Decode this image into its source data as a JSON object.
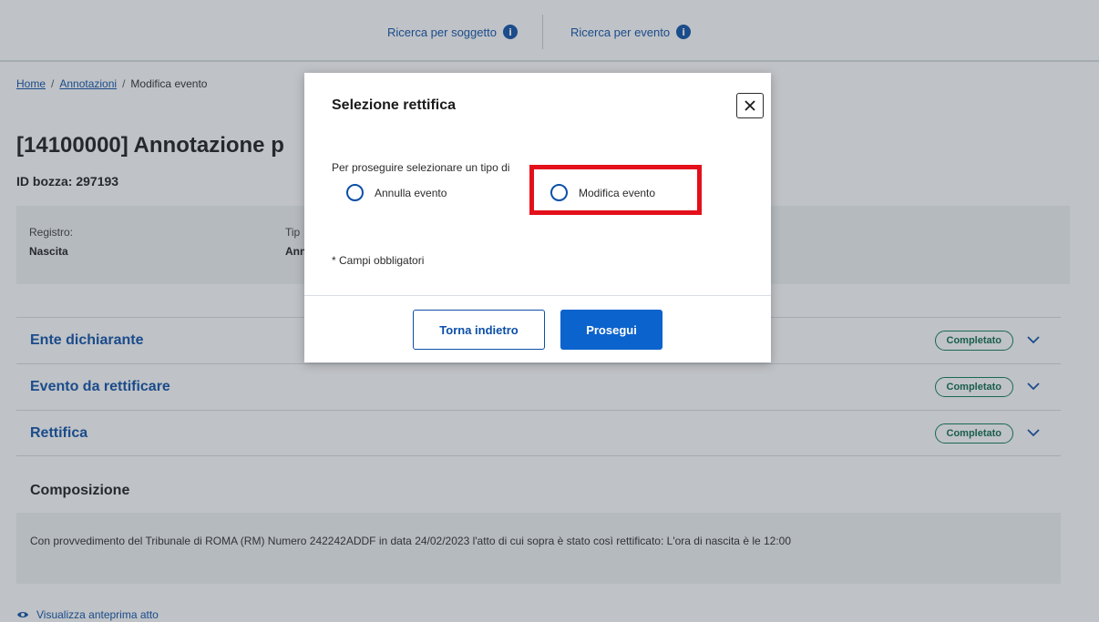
{
  "header": {
    "nav_subject": "Ricerca per soggetto",
    "nav_event": "Ricerca per evento",
    "info_glyph": "i"
  },
  "breadcrumb": {
    "home": "Home",
    "sep": "/",
    "annotations": "Annotazioni",
    "current": "Modifica evento"
  },
  "page": {
    "title": "[14100000] Annotazione p",
    "draft_id": "ID bozza: 297193"
  },
  "info_box": {
    "registry_label": "Registro:",
    "registry_value": "Nascita",
    "type_label": "Tip",
    "type_value": "Ann"
  },
  "accordion": {
    "items": [
      {
        "title": "Ente dichiarante",
        "status": "Completato"
      },
      {
        "title": "Evento da rettificare",
        "status": "Completato"
      },
      {
        "title": "Rettifica",
        "status": "Completato"
      }
    ]
  },
  "composition": {
    "title": "Composizione",
    "text": "Con provvedimento del Tribunale di ROMA (RM) Numero 242242ADDF in data 24/02/2023 l'atto di cui sopra è stato così rettificato: L'ora di nascita è le 12:00"
  },
  "preview_link": "Visualizza anteprima atto",
  "modal": {
    "title": "Selezione rettifica",
    "prompt": "Per proseguire selezionare un tipo di",
    "options": [
      {
        "label": "Annulla evento"
      },
      {
        "label": "Modifica evento"
      }
    ],
    "required_note": "* Campi obbligatori",
    "back_button": "Torna indietro",
    "continue_button": "Prosegui"
  },
  "colors": {
    "accent": "#0b4fa8",
    "primary_button": "#0b63ce",
    "status_green": "#0a7a55",
    "highlight_red": "#e3101b"
  },
  "icons": {
    "info": "info-icon",
    "close": "close-icon",
    "chevron": "chevron-down-icon",
    "eye": "eye-icon"
  }
}
